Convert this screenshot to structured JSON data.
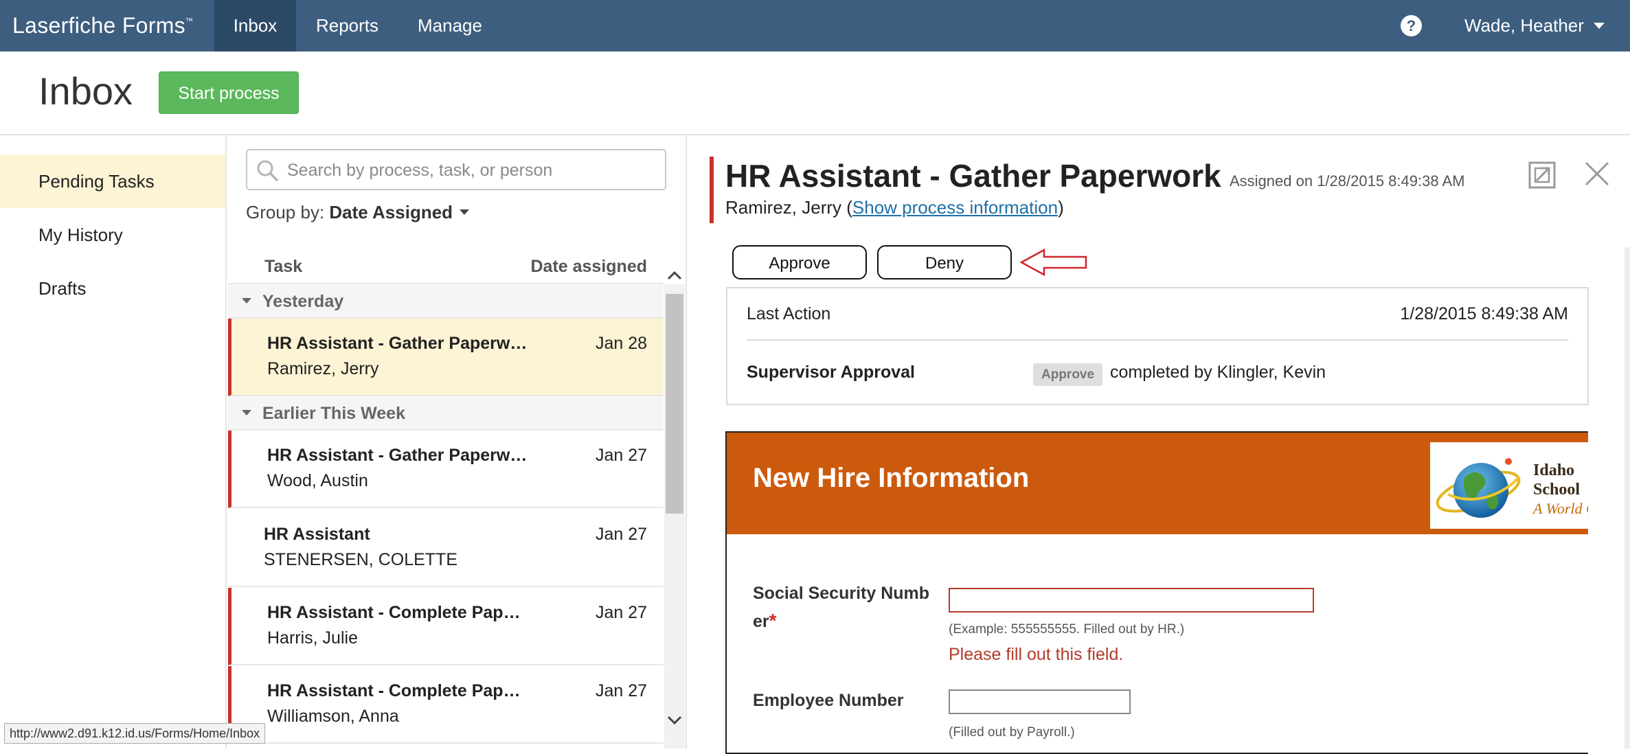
{
  "app": {
    "brand": "Laserfiche Forms",
    "brand_tm": "™",
    "nav": {
      "inbox": "Inbox",
      "reports": "Reports",
      "manage": "Manage"
    },
    "help": "?",
    "user": "Wade, Heather"
  },
  "header": {
    "title": "Inbox",
    "start_process": "Start process"
  },
  "sidebar": {
    "items": [
      {
        "label": "Pending Tasks",
        "active": true
      },
      {
        "label": "My History"
      },
      {
        "label": "Drafts"
      }
    ]
  },
  "list": {
    "search_placeholder": "Search by process, task, or person",
    "group_by_label": "Group by:",
    "group_by_value": "Date Assigned",
    "col_task": "Task",
    "col_date": "Date assigned",
    "groups": [
      {
        "label": "Yesterday"
      },
      {
        "label": "Earlier This Week"
      }
    ],
    "tasks": [
      {
        "name": "HR Assistant - Gather Paperwork",
        "date": "Jan 28",
        "person": "Ramirez, Jerry"
      },
      {
        "name": "HR Assistant - Gather Paperwork",
        "date": "Jan 27",
        "person": "Wood, Austin"
      },
      {
        "name": "HR Assistant",
        "date": "Jan 27",
        "person": "STENERSEN, COLETTE"
      },
      {
        "name": "HR Assistant - Complete Paperwork",
        "date": "Jan 27",
        "person": "Harris, Julie"
      },
      {
        "name": "HR Assistant - Complete Paperwork",
        "date": "Jan 27",
        "person": "Williamson, Anna"
      }
    ]
  },
  "status_bar": {
    "url": "http://www2.d91.k12.id.us/Forms/Home/Inbox"
  },
  "detail": {
    "title": "HR Assistant - Gather Paperwork",
    "assigned_on": "Assigned on 1/28/2015 8:49:38 AM",
    "person": "Ramirez, Jerry",
    "paren_open": "(",
    "paren_close": ")",
    "show_process_link": "Show process information",
    "approve": "Approve",
    "deny": "Deny",
    "last_action_label": "Last Action",
    "last_action_time": "1/28/2015 8:49:38 AM",
    "step_label": "Supervisor Approval",
    "step_badge": "Approve",
    "step_result": "completed by Klingler, Kevin"
  },
  "form": {
    "title": "New Hire Information",
    "logo_line1": "Idaho",
    "logo_line2": "School",
    "logo_line3": "A World C",
    "ssn_label_1": "Social Security Numb",
    "ssn_label_2": "er",
    "required_mark": "*",
    "ssn_help": "(Example: 555555555. Filled out by HR.)",
    "ssn_error": "Please fill out this field.",
    "emp_label": "Employee Number",
    "emp_help": "(Filled out by Payroll.)"
  },
  "colors": {
    "nav_bg": "#3d5e7f",
    "nav_active": "#2c4a66",
    "start_button": "#5cb85c",
    "selected_row": "#fdf3d5",
    "flag_red": "#c9302c",
    "form_banner": "#cc5a0c",
    "link": "#1e6fa8"
  }
}
